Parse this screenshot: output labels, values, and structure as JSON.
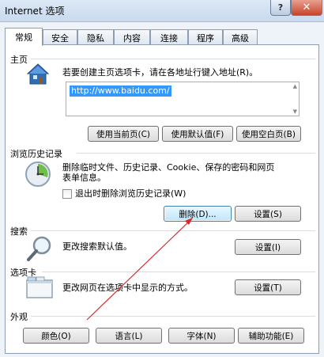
{
  "window": {
    "title": "Internet 选项",
    "help_label": "?",
    "close_label": "✕"
  },
  "tabs": [
    {
      "label": "常规"
    },
    {
      "label": "安全"
    },
    {
      "label": "隐私"
    },
    {
      "label": "内容"
    },
    {
      "label": "连接"
    },
    {
      "label": "程序"
    },
    {
      "label": "高级"
    }
  ],
  "homepage": {
    "group_title": "主页",
    "instruction": "若要创建主页选项卡，请在各地址行键入地址(R)。",
    "url": "http://www.baidu.com/",
    "buttons": {
      "use_current": "使用当前页(C)",
      "use_default": "使用默认值(F)",
      "use_blank": "使用空白页(B)"
    }
  },
  "history": {
    "group_title": "浏览历史记录",
    "description_line1": "删除临时文件、历史记录、Cookie、保存的密码和网页",
    "description_line2": "表单信息。",
    "checkbox_label": "退出时删除浏览历史记录(W)",
    "delete_button": "删除(D)...",
    "settings_button": "设置(S)"
  },
  "search": {
    "group_title": "搜索",
    "description": "更改搜索默认值。",
    "settings_button": "设置(I)"
  },
  "tabs_section": {
    "group_title": "选项卡",
    "description": "更改网页在选项卡中显示的方式。",
    "settings_button": "设置(T)"
  },
  "appearance": {
    "group_title": "外观",
    "buttons": {
      "colors": "颜色(O)",
      "languages": "语言(L)",
      "fonts": "字体(N)",
      "accessibility": "辅助功能(E)"
    }
  },
  "colors": {
    "accent": "#3399ff",
    "annotation_arrow": "#d9262b"
  }
}
